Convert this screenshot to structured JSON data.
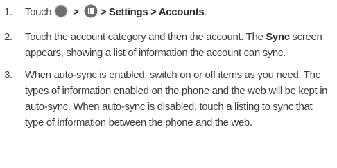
{
  "steps": [
    {
      "number": "1.",
      "touch": "Touch",
      "separator": ">",
      "path_tail": "> Settings > Accounts",
      "period": ".",
      "icons": [
        "home-button-icon",
        "all-apps-icon"
      ]
    },
    {
      "number": "2.",
      "text_before": "Touch the account category and then the account. The ",
      "bold_word": "Sync",
      "text_after": " screen appears, showing a list of information the account can sync."
    },
    {
      "number": "3.",
      "text": "When auto-sync is enabled, switch on or off items as you need. The types of information enabled on the phone and the web will be kept in auto-sync. When auto-sync is disabled, touch a listing to sync that type of information between the phone and the web."
    }
  ],
  "colors": {
    "text": "#3c3c3c",
    "icon_fill": "#6e6e6e",
    "icon_ring": "#b4b4b4"
  }
}
